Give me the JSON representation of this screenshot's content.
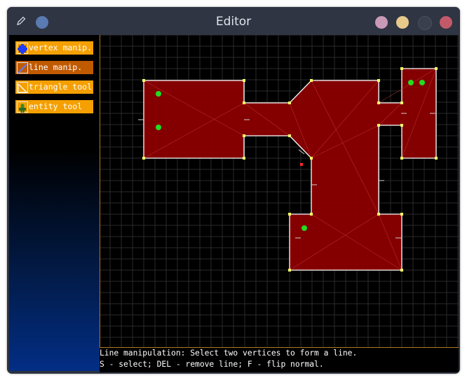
{
  "window": {
    "title": "Editor",
    "close_color": "#c25a6a",
    "min_color": "#e7c98a",
    "max_color": "#3a3f4c",
    "menu_color": "#c99ab8",
    "pin_color": "#5a7ab2"
  },
  "tools": [
    {
      "label": "vertex manip.",
      "icon": "vertex-icon"
    },
    {
      "label": "line manip.",
      "icon": "line-icon"
    },
    {
      "label": "triangle tool",
      "icon": "triangle-icon"
    },
    {
      "label": "entity tool",
      "icon": "entity-icon"
    }
  ],
  "status": {
    "line1": "Line manipulation: Select two vertices to form a line.",
    "line2": "S - select; DEL - remove line; F - flip normal."
  },
  "colors": {
    "shape_fill": "#8b0000",
    "edge": "#ffffff",
    "vertex": "#ffff66",
    "entity": "#22dd22",
    "grid": "#2a2a2a",
    "tool_bg": "#f5a000",
    "tool_active_bg": "#c05a00"
  }
}
